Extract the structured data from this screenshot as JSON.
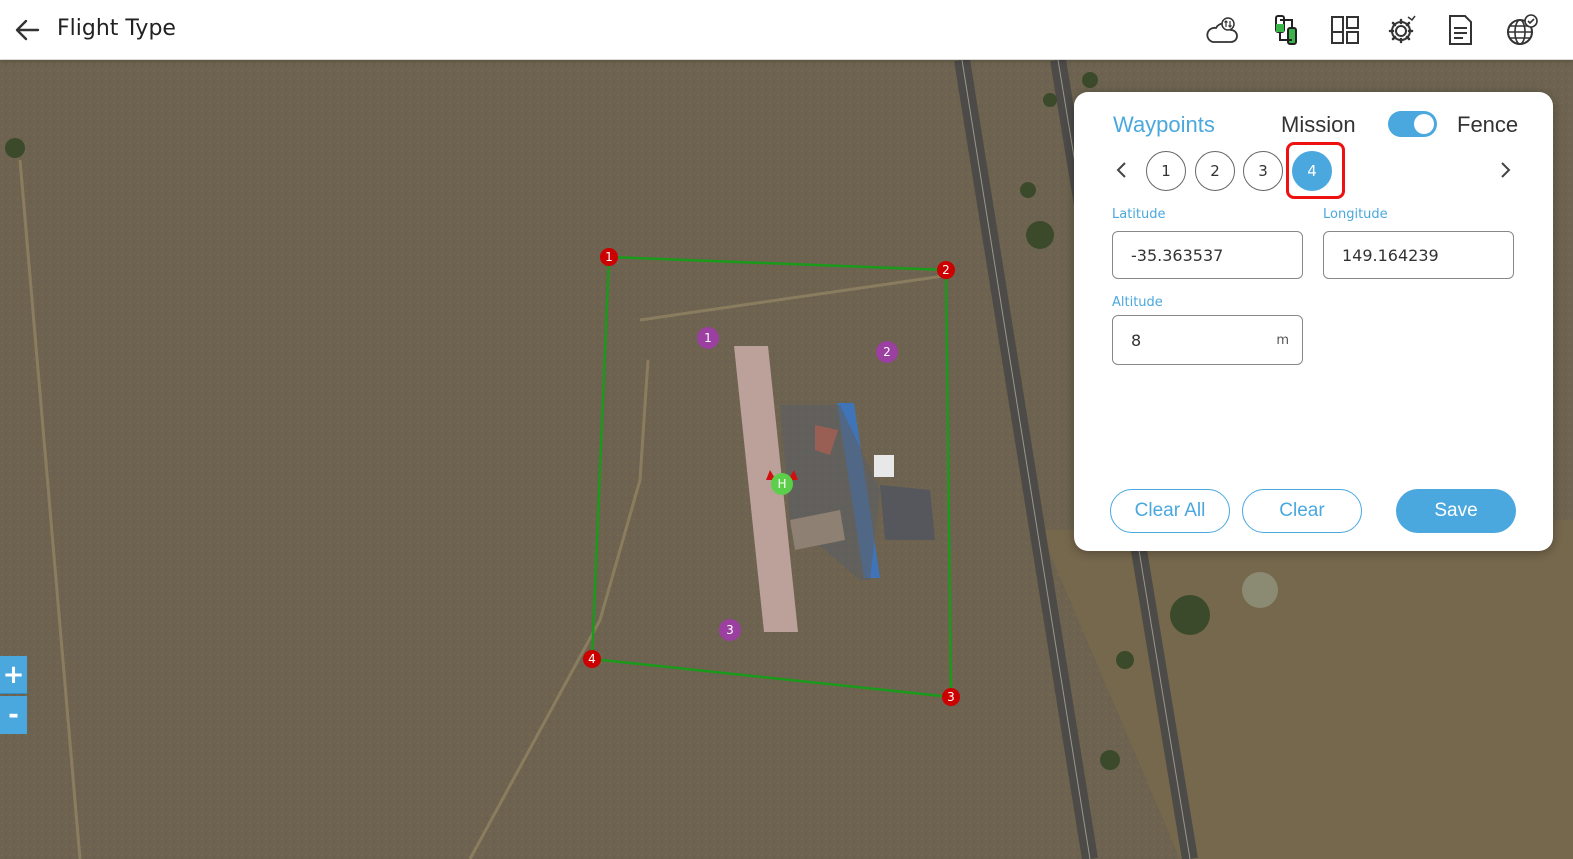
{
  "header": {
    "title": "Flight Type",
    "icons": [
      "back-arrow-icon",
      "weather-sync-icon",
      "vehicle-link-icon",
      "dashboard-layout-icon",
      "settings-icon",
      "log-document-icon",
      "globe-check-icon"
    ]
  },
  "map": {
    "fence_markers": [
      "1",
      "2",
      "3",
      "4"
    ],
    "waypoint_markers": [
      "1",
      "2",
      "3"
    ],
    "home_marker": "H",
    "zoom_in": "+",
    "zoom_out": "-"
  },
  "panel": {
    "tabs": {
      "waypoints": "Waypoints",
      "mission": "Mission",
      "fence": "Fence"
    },
    "toggle_on": true,
    "points": [
      "1",
      "2",
      "3",
      "4"
    ],
    "active_point": "4",
    "latitude_label": "Latitude",
    "latitude_value": "-35.363537",
    "longitude_label": "Longitude",
    "longitude_value": "149.164239",
    "altitude_label": "Altitude",
    "altitude_value": "8",
    "altitude_unit": "m",
    "clear_all": "Clear All",
    "clear": "Clear",
    "save": "Save"
  },
  "colors": {
    "accent": "#4aa8df",
    "fence_line": "#1a9a1a",
    "fence_marker": "#cc0000",
    "waypoint_marker": "#9b3fa0",
    "home_marker": "#5ccf4a"
  }
}
